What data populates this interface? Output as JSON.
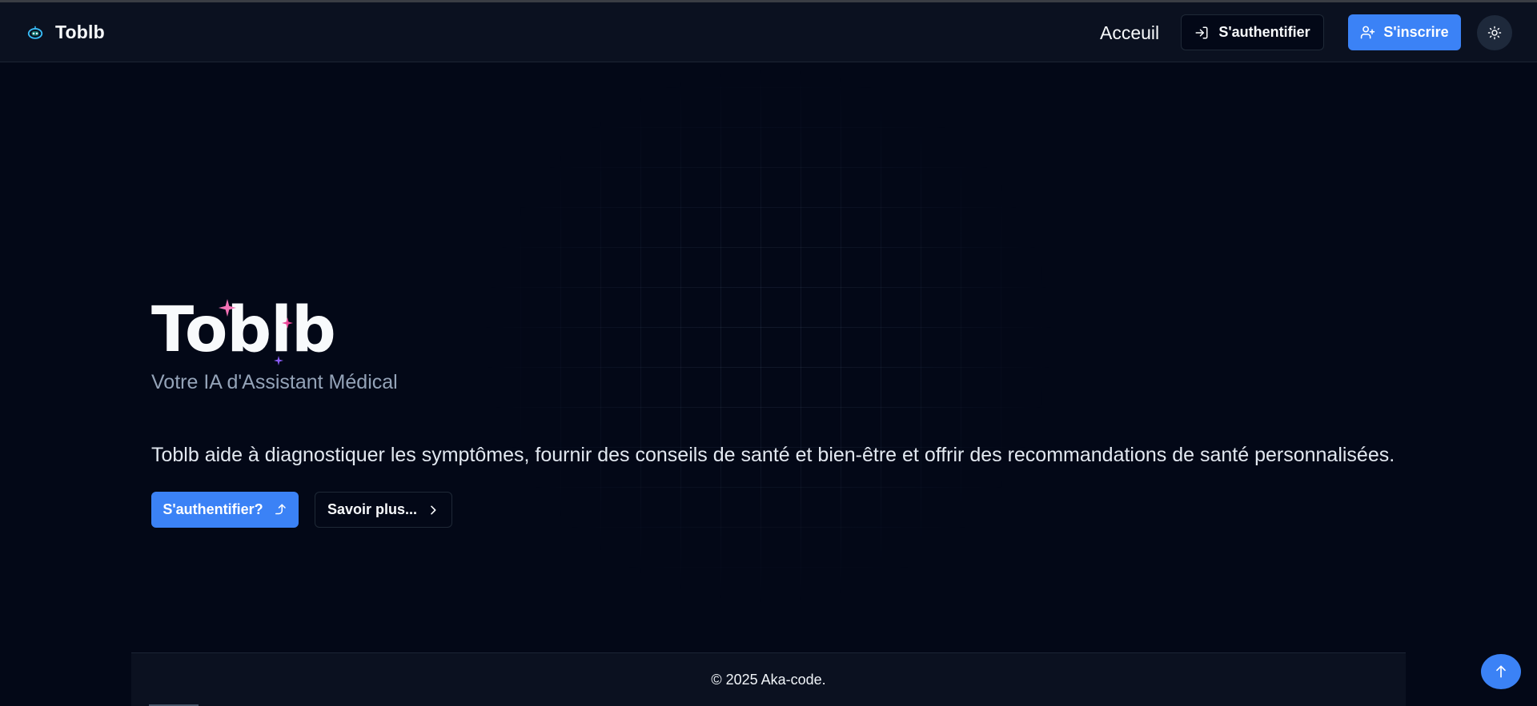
{
  "colors": {
    "background": "#030817",
    "navbar": "#0b1120",
    "accent": "#3b82f6",
    "muted_text": "#94a3b8",
    "sparkle_pink": "#f472b6",
    "sparkle_purple": "#8b5cf6"
  },
  "navbar": {
    "brand_name": "Toblb",
    "brand_icon": "robot-icon",
    "home_label": "Acceuil",
    "login_label": "S'authentifier",
    "login_icon": "log-in-icon",
    "signup_label": "S'inscrire",
    "signup_icon": "user-plus-icon",
    "theme_icon": "sun-icon"
  },
  "hero": {
    "title": "Toblb",
    "subtitle": "Votre IA d'Assistant Médical",
    "description": "Toblb aide à diagnostiquer les symptômes, fournir des conseils de santé et bien-être et offrir des recommandations de santé personnalisées.",
    "cta_label": "S'authentifier?",
    "cta_icon": "corner-up-arrow-icon",
    "more_label": "Savoir plus...",
    "more_icon": "chevron-right-icon"
  },
  "footer": {
    "copyright": "© 2025 Aka-code."
  },
  "scroll_top_icon": "arrow-up-icon"
}
